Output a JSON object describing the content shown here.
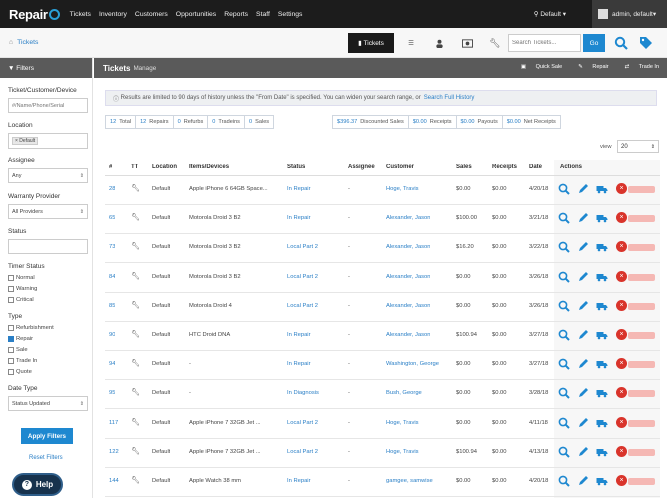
{
  "app": {
    "logo_text": "Repair",
    "nav": [
      "Tickets",
      "Inventory",
      "Customers",
      "Opportunities",
      "Reports",
      "Staff",
      "Settings"
    ],
    "location": "Default",
    "user": "admin, default"
  },
  "toolbar": {
    "breadcrumb": "Tickets",
    "tickets_btn": "Tickets",
    "search_placeholder": "Search Tickets...",
    "go_label": "Go"
  },
  "sidebar": {
    "title": "Filters",
    "search_label": "Ticket/Customer/Device",
    "search_placeholder": "#/Name/Phone/Serial",
    "location_label": "Location",
    "location_chip": "× Default",
    "assignee_label": "Assignee",
    "assignee_value": "Any",
    "warranty_label": "Warranty Provider",
    "warranty_value": "All Providers",
    "status_label": "Status",
    "timer_label": "Timer Status",
    "timer_options": [
      {
        "label": "Normal",
        "checked": false
      },
      {
        "label": "Warning",
        "checked": false
      },
      {
        "label": "Critical",
        "checked": false
      }
    ],
    "type_label": "Type",
    "type_options": [
      {
        "label": "Refurbishment",
        "checked": false
      },
      {
        "label": "Repair",
        "checked": true
      },
      {
        "label": "Sale",
        "checked": false
      },
      {
        "label": "Trade In",
        "checked": false
      },
      {
        "label": "Quote",
        "checked": false
      }
    ],
    "date_type_label": "Date Type",
    "date_type_value": "Status Updated",
    "apply_label": "Apply Filters",
    "reset_label": "Reset Filters",
    "help_label": "Help"
  },
  "main": {
    "title": "Tickets",
    "subtitle": "Manage",
    "actions": [
      "Quick Sale",
      "Repair",
      "Trade In"
    ],
    "info_text": "Results are limited to 90 days of history unless the \"From Date\" is specified. You can widen your search range, or",
    "info_link": "Search Full History",
    "summary_left": [
      {
        "value": "12",
        "label": "Total"
      },
      {
        "value": "12",
        "label": "Repairs"
      },
      {
        "value": "0",
        "label": "Refurbs"
      },
      {
        "value": "0",
        "label": "Tradeins"
      },
      {
        "value": "0",
        "label": "Sales"
      }
    ],
    "summary_right": [
      {
        "value": "$396.37",
        "label": "Discounted Sales"
      },
      {
        "value": "$0.00",
        "label": "Receipts"
      },
      {
        "value": "$0.00",
        "label": "Payouts"
      },
      {
        "value": "$0.00",
        "label": "Net Receipts"
      }
    ],
    "view_label": "view",
    "view_value": "20",
    "columns": [
      "#",
      "TT",
      "Location",
      "Items/Devices",
      "Status",
      "Assignee",
      "Customer",
      "Sales",
      "Receipts",
      "Date",
      "Actions"
    ],
    "rows": [
      {
        "id": "28",
        "location": "Default",
        "item": "Apple iPhone 6 64GB Space...",
        "status": "In Repair",
        "assignee": "-",
        "customer": "Hoge, Travis",
        "sales": "$0.00",
        "receipts": "$0.00",
        "date": "4/20/18"
      },
      {
        "id": "65",
        "location": "Default",
        "item": "Motorola Droid 3 B2",
        "status": "In Repair",
        "assignee": "-",
        "customer": "Alexander, Jason",
        "sales": "$100.00",
        "receipts": "$0.00",
        "date": "3/21/18"
      },
      {
        "id": "73",
        "location": "Default",
        "item": "Motorola Droid 3 B2",
        "status": "Local Part 2",
        "assignee": "-",
        "customer": "Alexander, Jason",
        "sales": "$16.20",
        "receipts": "$0.00",
        "date": "3/22/18"
      },
      {
        "id": "84",
        "location": "Default",
        "item": "Motorola Droid 3 B2",
        "status": "Local Part 2",
        "assignee": "-",
        "customer": "Alexander, Jason",
        "sales": "$0.00",
        "receipts": "$0.00",
        "date": "3/26/18"
      },
      {
        "id": "85",
        "location": "Default",
        "item": "Motorola Droid 4",
        "status": "Local Part 2",
        "assignee": "-",
        "customer": "Alexander, Jason",
        "sales": "$0.00",
        "receipts": "$0.00",
        "date": "3/26/18"
      },
      {
        "id": "90",
        "location": "Default",
        "item": "HTC Droid DNA",
        "status": "In Repair",
        "assignee": "-",
        "customer": "Alexander, Jason",
        "sales": "$100.94",
        "receipts": "$0.00",
        "date": "3/27/18"
      },
      {
        "id": "94",
        "location": "Default",
        "item": "-",
        "status": "In Repair",
        "assignee": "-",
        "customer": "Washington, George",
        "sales": "$0.00",
        "receipts": "$0.00",
        "date": "3/27/18"
      },
      {
        "id": "95",
        "location": "Default",
        "item": "-",
        "status": "In Diagnosis",
        "assignee": "-",
        "customer": "Bush, George",
        "sales": "$0.00",
        "receipts": "$0.00",
        "date": "3/28/18"
      },
      {
        "id": "117",
        "location": "Default",
        "item": "Apple iPhone 7 32GB Jet ...",
        "status": "Local Part 2",
        "assignee": "-",
        "customer": "Hoge, Travis",
        "sales": "$0.00",
        "receipts": "$0.00",
        "date": "4/11/18"
      },
      {
        "id": "122",
        "location": "Default",
        "item": "Apple iPhone 7 32GB Jet ...",
        "status": "Local Part 2",
        "assignee": "-",
        "customer": "Hoge, Travis",
        "sales": "$100.94",
        "receipts": "$0.00",
        "date": "4/13/18"
      },
      {
        "id": "144",
        "location": "Default",
        "item": "Apple Watch 38 mm",
        "status": "In Repair",
        "assignee": "-",
        "customer": "gamgee, samwise",
        "sales": "$0.00",
        "receipts": "$0.00",
        "date": "4/20/18"
      }
    ]
  },
  "colors": {
    "accent": "#1e88d0",
    "dark": "#1c1c1c",
    "header": "#5a5a5a",
    "danger": "#d9342b"
  }
}
